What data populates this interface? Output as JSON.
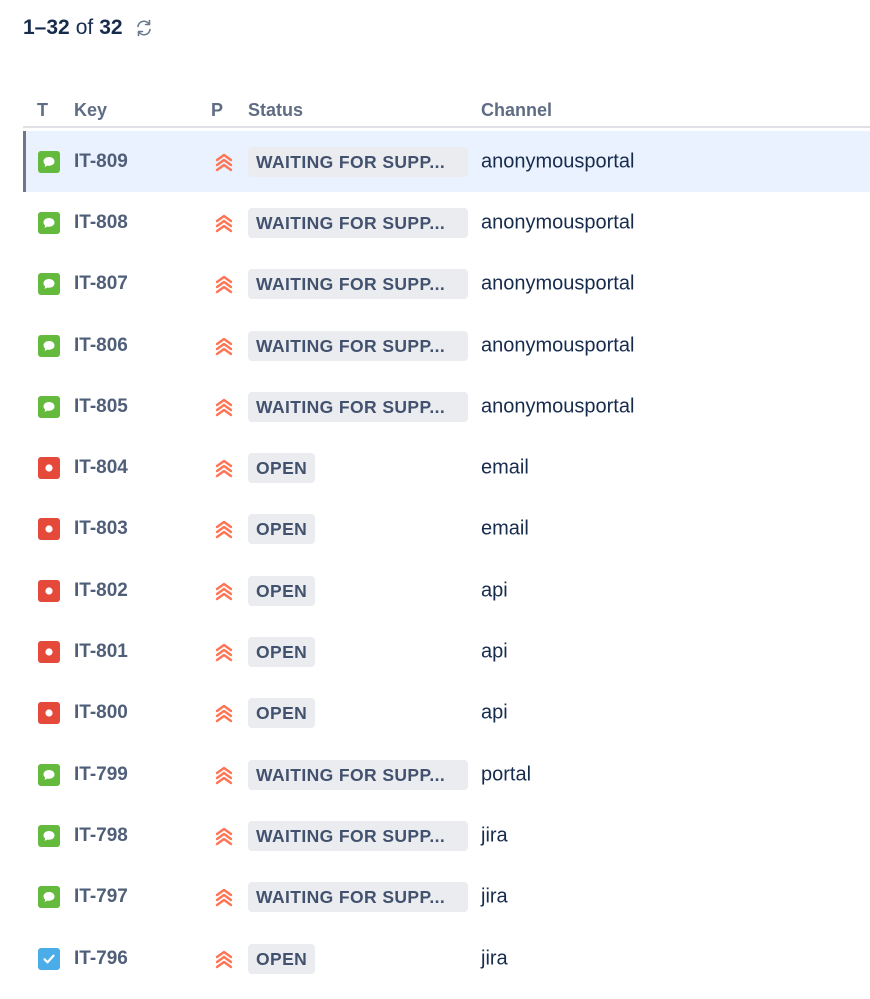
{
  "pagination": {
    "range": "1–32",
    "of": "of",
    "total": "32"
  },
  "columns": {
    "type": "T",
    "key": "Key",
    "priority": "P",
    "status": "Status",
    "channel": "Channel"
  },
  "colors": {
    "chat": "#63ba3c",
    "bug": "#e5493a",
    "task": "#4bade8",
    "priority": "#ff7452",
    "selected_bg": "#e9f2fe"
  },
  "rows": [
    {
      "type": "chat-icon",
      "key": "IT-809",
      "status": "WAITING FOR SUPP...",
      "channel": "anonymousportal",
      "selected": true
    },
    {
      "type": "chat-icon",
      "key": "IT-808",
      "status": "WAITING FOR SUPP...",
      "channel": "anonymousportal"
    },
    {
      "type": "chat-icon",
      "key": "IT-807",
      "status": "WAITING FOR SUPP...",
      "channel": "anonymousportal"
    },
    {
      "type": "chat-icon",
      "key": "IT-806",
      "status": "WAITING FOR SUPP...",
      "channel": "anonymousportal"
    },
    {
      "type": "chat-icon",
      "key": "IT-805",
      "status": "WAITING FOR SUPP...",
      "channel": "anonymousportal"
    },
    {
      "type": "bug-icon",
      "key": "IT-804",
      "status": "OPEN",
      "channel": "email"
    },
    {
      "type": "bug-icon",
      "key": "IT-803",
      "status": "OPEN",
      "channel": "email"
    },
    {
      "type": "bug-icon",
      "key": "IT-802",
      "status": "OPEN",
      "channel": "api"
    },
    {
      "type": "bug-icon",
      "key": "IT-801",
      "status": "OPEN",
      "channel": "api"
    },
    {
      "type": "bug-icon",
      "key": "IT-800",
      "status": "OPEN",
      "channel": "api"
    },
    {
      "type": "chat-icon",
      "key": "IT-799",
      "status": "WAITING FOR SUPP...",
      "channel": "portal"
    },
    {
      "type": "chat-icon",
      "key": "IT-798",
      "status": "WAITING FOR SUPP...",
      "channel": "jira"
    },
    {
      "type": "chat-icon",
      "key": "IT-797",
      "status": "WAITING FOR SUPP...",
      "channel": "jira"
    },
    {
      "type": "task-icon",
      "key": "IT-796",
      "status": "OPEN",
      "channel": "jira"
    }
  ]
}
